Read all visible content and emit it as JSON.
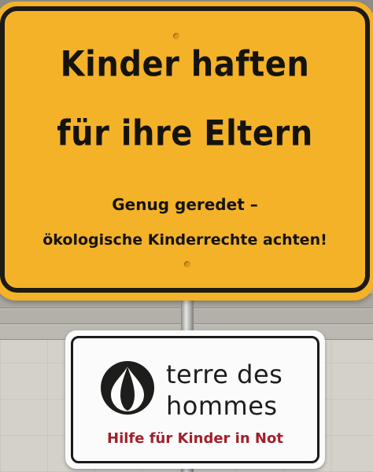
{
  "yellow_sign": {
    "line1": "Kinder haften",
    "line2": "für ihre Eltern",
    "line3": "Genug geredet –",
    "line4": "ökologische Kinderrechte achten!",
    "background_color": "#f4b229",
    "text_color": "#15130f"
  },
  "white_sign": {
    "logo_icon": "drop-in-circle-icon",
    "brand_line1": "terre des",
    "brand_line2": "hommes",
    "slogan": "Hilfe für Kinder in Not",
    "slogan_color": "#a21f2b"
  }
}
